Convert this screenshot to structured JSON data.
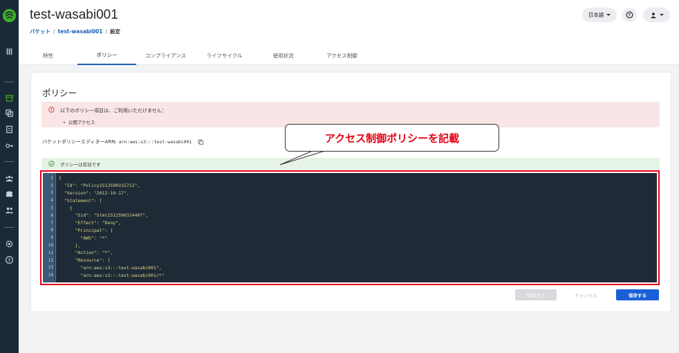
{
  "header": {
    "title": "test-wasabi001",
    "breadcrumb": [
      "バケット",
      "test-wasabi001",
      "設定"
    ],
    "language": "日本語",
    "help_icon": "help-circle-icon",
    "user_icon": "user-icon"
  },
  "tabs": [
    {
      "label": "特性"
    },
    {
      "label": "ポリシー",
      "active": true
    },
    {
      "label": "コンプライアンス"
    },
    {
      "label": "ライフサイクル"
    },
    {
      "label": "使用状況"
    },
    {
      "label": "アクセス制御"
    }
  ],
  "policy": {
    "title": "ポリシー",
    "alert_message": "以下のポリシー項目は、ご利用いただけません：",
    "alert_items": [
      "公開アクセス"
    ],
    "arn_label": "バケットポリシーエディターARN:",
    "arn_value": "arn:aws:s3:::test-wasabi001",
    "valid_message": "ポリシーは有効です",
    "code_lines": [
      "{",
      "  \"Id\": \"Policy1512590315712\",",
      "  \"Version\": \"2012-10-17\",",
      "  \"Statement\": [",
      "    {",
      "      \"Sid\": \"Stmt1512590314407\",",
      "      \"Effect\": \"Deny\",",
      "      \"Principal\": {",
      "        \"AWS\": \"*\"",
      "      },",
      "      \"Action\": \"*\",",
      "      \"Resource\": [",
      "        \"arn:aws:s3:::test-wasabi001\",",
      "        \"arn:aws:s3:::test-wasabi001/*\""
    ],
    "buttons": {
      "delete": "削除する",
      "cancel": "キャンセル",
      "save": "保存する"
    }
  },
  "annotation": "アクセス制御ポリシーを記載",
  "colors": {
    "sidebar": "#1b2a37",
    "accent": "#1a5fd6",
    "annotation_red": "#e60012",
    "editor_bg": "#1f2a37"
  }
}
